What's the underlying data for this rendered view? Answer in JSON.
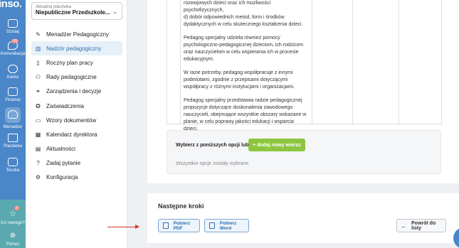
{
  "rail": {
    "logo": "inso.",
    "items": [
      {
        "label": "Dzisiaj",
        "icon": "calendar-icon"
      },
      {
        "label": "Komunikacja",
        "icon": "chat-icon",
        "badge": "99"
      },
      {
        "label": "Kadra",
        "icon": "people-icon"
      },
      {
        "label": "Finanse",
        "icon": "wallet-icon"
      },
      {
        "label": "Menadżer",
        "icon": "person-icon"
      },
      {
        "label": "Placówka",
        "icon": "building-icon"
      },
      {
        "label": "Teczka",
        "icon": "folder-icon"
      }
    ],
    "bottom": [
      {
        "label": "Co nowego?",
        "icon": "star-icon",
        "badge": "9"
      },
      {
        "label": "Pomoc",
        "icon": "globe-icon"
      }
    ]
  },
  "sidebar": {
    "facility_caption": "Aktualna placówka",
    "facility_value": "Niepubliczne Przedszkole...",
    "items": [
      {
        "label": "Menadżer Pedagogiczny",
        "icon": "pen-icon"
      },
      {
        "label": "Nadzór pedagogiczny",
        "icon": "chart-icon",
        "active": true
      },
      {
        "label": "Roczny plan pracy",
        "icon": "clipboard-icon"
      },
      {
        "label": "Rady pedagogiczne",
        "icon": "group-icon"
      },
      {
        "label": "Zarządzenia i decyzje",
        "icon": "handshake-icon"
      },
      {
        "label": "Zaświadczenia",
        "icon": "certificate-icon"
      },
      {
        "label": "Wzory dokumentów",
        "icon": "document-icon"
      },
      {
        "label": "Kalendarz dyrektora",
        "icon": "calendar-check-icon"
      },
      {
        "label": "Aktualności",
        "icon": "news-icon"
      },
      {
        "label": "Zadaj pytanie",
        "icon": "question-icon"
      },
      {
        "label": "Konfiguracja",
        "icon": "gear-icon"
      }
    ]
  },
  "content": {
    "paragraphs": [
      "rozwojowych dzieci oraz ich możliwości psychofizycznych,\nd) dobór odpowiednich metod, form i środków dydaktycznych w celu skutecznego kształcenia dzieci.",
      "Pedagog specjalny udziela również pomocy psychologiczno-pedagogicznej dzieciom, ich rodzicom oraz nauczycielom w celu wspierania ich w procesie edukacyjnym.",
      "W razie potrzeby, pedagog współpracuje z innymi podmiotami, zgodnie z przepisami dotyczącymi współpracy z różnymi instytucjami i organizacjami.",
      "Pedagog specjalny przedstawia radzie pedagogicznej propozycje dotyczące doskonalenia zawodowego nauczycieli, obejmujące wszystkie obszary wskazane w planie, w celu poprawy jakości edukacji i wsparcia dzieci."
    ],
    "choose_label": "Wybierz z poniższych opcji lub",
    "add_button": "+ dodaj nowy wiersz",
    "all_selected": "Wszystkie opcje zostały wybrane"
  },
  "next_steps": {
    "title": "Następne kroki",
    "pdf_button": "Pobierz PDF",
    "word_button": "Pobierz Word",
    "back_button": "Powrót do listy"
  }
}
